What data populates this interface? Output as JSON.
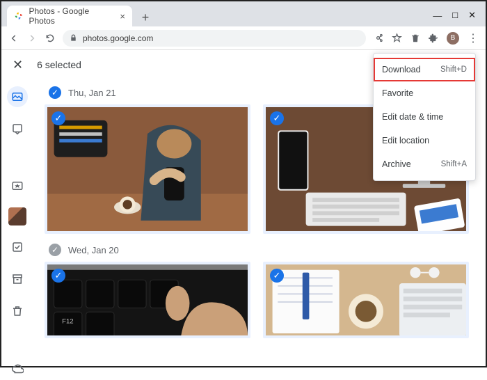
{
  "window": {
    "tab_title": "Photos - Google Photos",
    "url": "photos.google.com",
    "avatar_initial": "B"
  },
  "selection": {
    "count_label": "6 selected"
  },
  "dates": {
    "d1": "Thu, Jan 21",
    "d2": "Wed, Jan 20"
  },
  "menu": {
    "download": "Download",
    "download_shortcut": "Shift+D",
    "favorite": "Favorite",
    "edit_datetime": "Edit date & time",
    "edit_location": "Edit location",
    "archive": "Archive",
    "archive_shortcut": "Shift+A"
  }
}
